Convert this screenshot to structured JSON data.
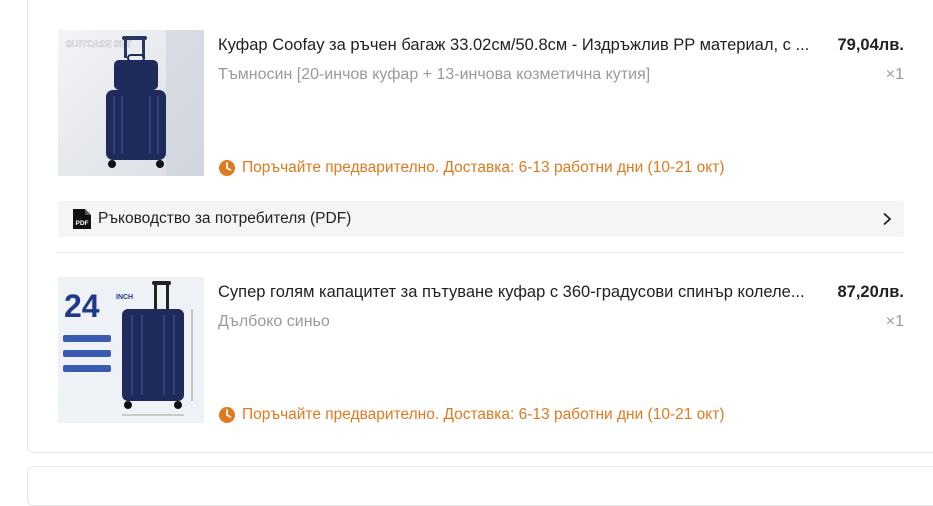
{
  "items": [
    {
      "title": "Куфар Coofay за ръчен багаж 33.02см/50.8см - Издръжлив PP материал, с ...",
      "price": "79,04лв.",
      "variant": "Тъмносин [20-инчов куфар + 13-инчова козметична кутия]",
      "qty": "×1",
      "shipping": "Поръчайте предварително. Доставка: 6-13 работни дни (10-21 окт)",
      "image_label": "SUITCASE SET"
    },
    {
      "title": "Супер голям капацитет за пътуване куфар с 360-градусови спинър колеле...",
      "price": "87,20лв.",
      "variant": "Дълбоко синьо",
      "qty": "×1",
      "shipping": "Поръчайте предварително. Доставка: 6-13 работни дни (10-21 окт)",
      "image_label_num": "24",
      "image_label_unit": "INCH"
    }
  ],
  "manual": {
    "label": "Ръководство за потребителя (PDF)",
    "icon_text": "PDF"
  },
  "colors": {
    "accent": "#e07a1f",
    "muted": "#9a9a9a",
    "suitcase": "#1f2b5a"
  }
}
